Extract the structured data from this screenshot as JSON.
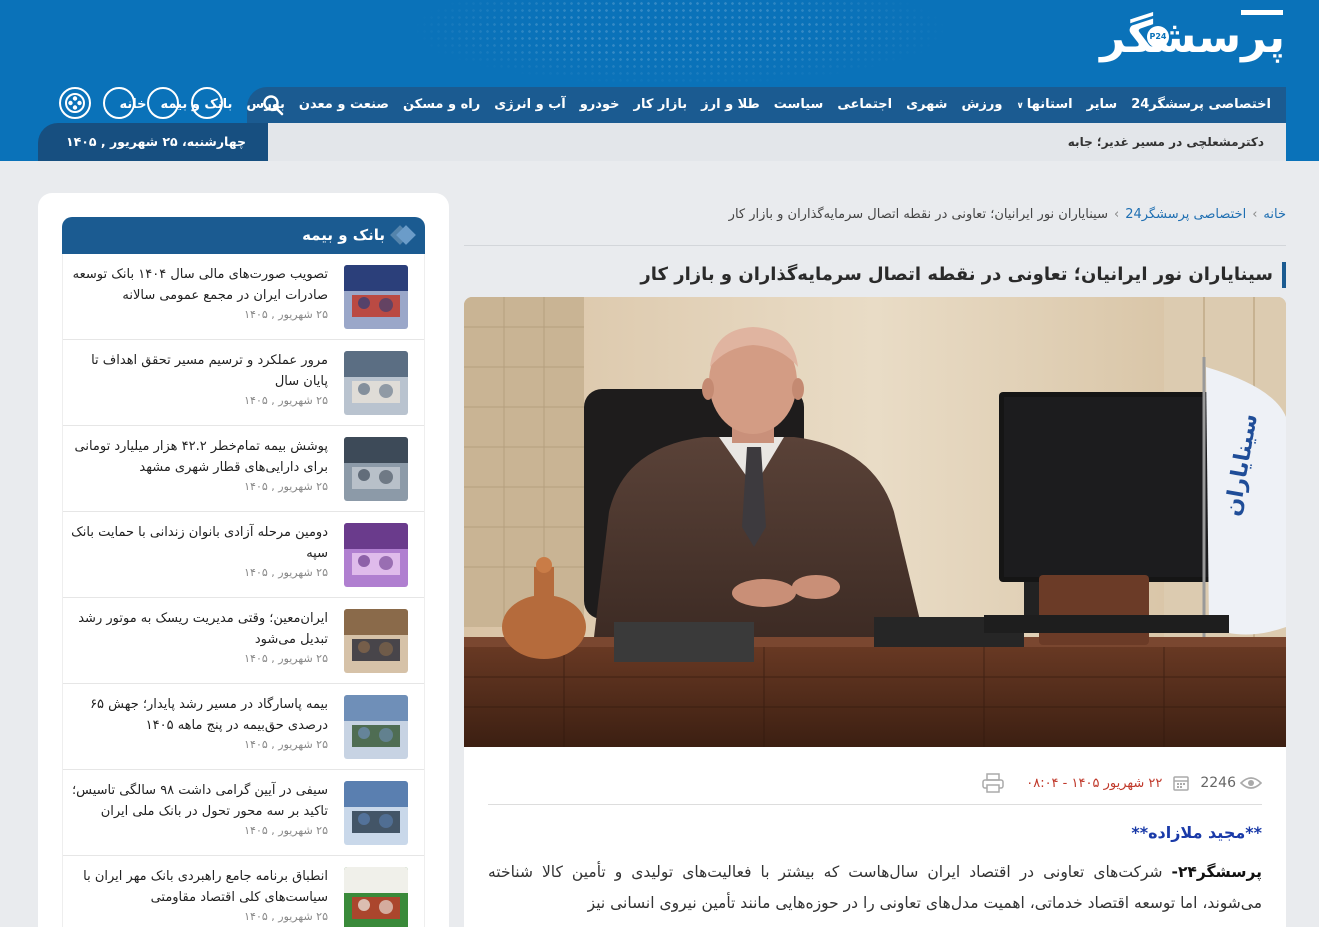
{
  "brand": {
    "logo_text": "پرسشگر",
    "logo_badge": "P24"
  },
  "nav": {
    "items": [
      {
        "label": "خانه"
      },
      {
        "label": "بانک و بیمه"
      },
      {
        "label": "بورس"
      },
      {
        "label": "صنعت و معدن"
      },
      {
        "label": "راه و مسکن"
      },
      {
        "label": "آب و انرژی"
      },
      {
        "label": "خودرو"
      },
      {
        "label": "بازار کار"
      },
      {
        "label": "طلا و ارز"
      },
      {
        "label": "سیاست"
      },
      {
        "label": "اجتماعی"
      },
      {
        "label": "شهری"
      },
      {
        "label": "ورزش"
      },
      {
        "label": "استانها",
        "has_dropdown": true
      },
      {
        "label": "سایر"
      },
      {
        "label": "اختصاصی پرسشگر24"
      }
    ],
    "search_icon": "search-icon"
  },
  "ticker": {
    "text": "دکترمشعلچی در مسیر غدیر؛ جابه"
  },
  "header_date": "چهارشنبه، ۲۵ شهریور , ۱۴۰۵",
  "social_icons": [
    "social-icon-1",
    "social-icon-2",
    "social-icon-3",
    "social-icon-4"
  ],
  "sidebar": {
    "section_title": "بانک و بیمه",
    "items": [
      {
        "title": "تصویب صورت‌های مالی سال ۱۴۰۴ بانک توسعه صادرات ایران در مجمع عمومی سالانه",
        "date": "۲۵ شهریور , ۱۴۰۵"
      },
      {
        "title": "مرور عملکرد و ترسیم مسیر تحقق اهداف تا پایان سال",
        "date": "۲۵ شهریور , ۱۴۰۵"
      },
      {
        "title": "پوشش بیمه تمام‌خطر ۴۲.۲ هزار میلیارد تومانی برای دارایی‌های قطار شهری مشهد",
        "date": "۲۵ شهریور , ۱۴۰۵"
      },
      {
        "title": "دومین مرحله آزادی بانوان زندانی با حمایت بانک سپه",
        "date": "۲۵ شهریور , ۱۴۰۵"
      },
      {
        "title": "ایران‌معین؛ وقتی مدیریت ریسک به موتور رشد تبدیل می‌شود",
        "date": "۲۵ شهریور , ۱۴۰۵"
      },
      {
        "title": "بیمه پاسارگاد در مسیر رشد پایدار؛ جهش ۶۵ درصدی حق‌بیمه در پنج ماهه ۱۴۰۵",
        "date": "۲۵ شهریور , ۱۴۰۵"
      },
      {
        "title": "سیفی در آیین گرامی داشت ۹۸ سالگی تاسیس؛ تاکید بر سه محور تحول در بانک ملی ایران",
        "date": "۲۵ شهریور , ۱۴۰۵"
      },
      {
        "title": "انطباق برنامه جامع راهبردی بانک مهر ایران با سیاست‌های کلی اقتصاد مقاومتی",
        "date": "۲۵ شهریور , ۱۴۰۵"
      }
    ]
  },
  "article": {
    "breadcrumb": {
      "home": "خانه",
      "category": "اختصاصی پرسشگر24",
      "current": "سینایاران نور ایرانیان؛ تعاونی در نقطه اتصال سرمایه‌گذاران و بازار کار"
    },
    "title": "سینایاران نور ایرانیان؛ تعاونی در نقطه اتصال سرمایه‌گذاران و بازار کار",
    "views": "2246",
    "datetime": "۲۲ شهریور ۱۴۰۵ - ۰۸:۰۴",
    "author": "**مجید ملازاده**",
    "lead_source": "پرسشگر۲۴-",
    "lead_text": " شرکت‌های تعاونی در اقتصاد ایران سال‌هاست که بیشتر با فعالیت‌های تولیدی و تأمین کالا شناخته می‌شوند، اما توسعه اقتصاد خدماتی، اهمیت مدل‌های تعاونی را در حوزه‌هایی مانند تأمین نیروی انسانی نیز"
  },
  "colors": {
    "header_blue": "#0a72b9",
    "nav_dark": "#1b5b91",
    "date_red": "#c0392b",
    "author_blue": "#1a3aa8"
  }
}
